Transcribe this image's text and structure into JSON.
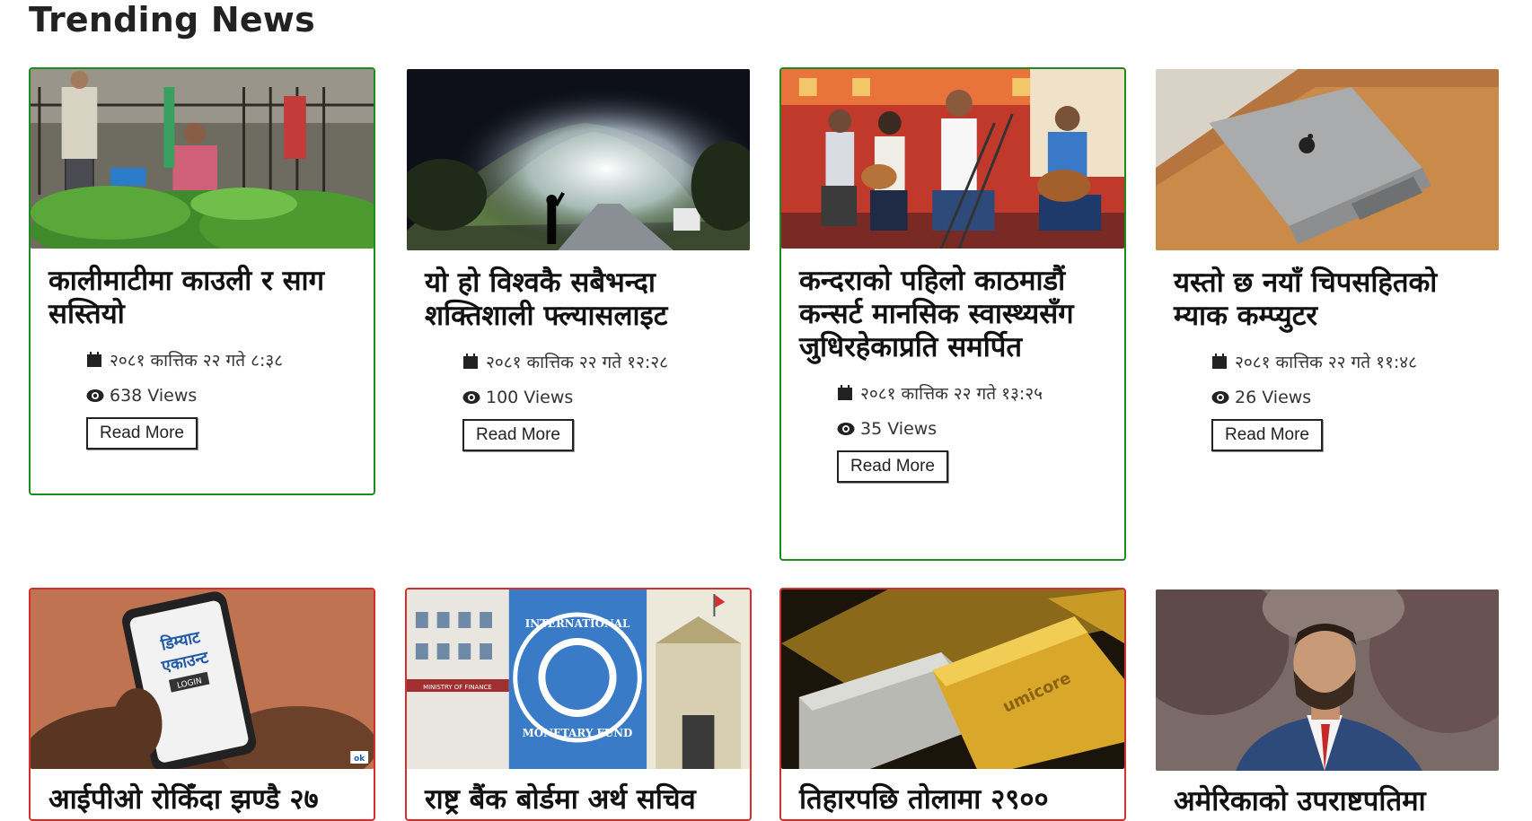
{
  "section": {
    "title": "Trending News"
  },
  "row1": [
    {
      "title": "कालीमाटीमा काउली र साग सस्तियो",
      "date": "२०८१ कात्तिक २२ गते ८:३८",
      "views": "638 Views",
      "read_more": "Read More",
      "image": "vegetable market"
    },
    {
      "title": "यो हो विश्वकै सबैभन्दा शक्तिशाली फ्ल्यासलाइट",
      "date": "२०८१ कात्तिक २२ गते १२:२८",
      "views": "100 Views",
      "read_more": "Read More",
      "image": "flashlight beam on hill at night"
    },
    {
      "title": "कन्दराको पहिलो काठमाडौं कन्सर्ट मानसिक स्वास्थ्यसँग जुधिरहेकाप्रति समर्पित",
      "date": "२०८१ कात्तिक २२ गते १३:२५",
      "views": "35 Views",
      "read_more": "Read More",
      "image": "band performing on stage"
    },
    {
      "title": "यस्तो छ नयाँ चिपसहितको म्याक कम्प्युटर",
      "date": "२०८१ कात्तिक २२ गते ११:४८",
      "views": "26 Views",
      "read_more": "Read More",
      "image": "laptop on desk"
    }
  ],
  "row2": [
    {
      "title": "आईपीओ रोकिँदा झण्डै २७",
      "image": "phone showing login",
      "phone_text_1": "डिम्याट",
      "phone_text_2": "एकाउन्ट",
      "phone_btn": "LOGIN",
      "badge": "ok"
    },
    {
      "title": "राष्ट्र बैंक बोर्डमा अर्थ सचिव",
      "image": "IMF logo with buildings",
      "imf_top": "INTERNATIONAL",
      "imf_bottom": "MONETARY FUND",
      "ministry_sign": "MINISTRY OF FINANCE"
    },
    {
      "title": "तिहारपछि तोलामा २९००",
      "image": "gold bars",
      "bar_text": "umicore"
    },
    {
      "title": "अमेरिकाको उपराष्टपतिमा",
      "image": "man in suit portrait"
    }
  ],
  "colors": {
    "green_border": "#1f8a1f",
    "red_border": "#d32f2f"
  },
  "icons": {
    "date": "calendar-icon",
    "views": "eye-icon"
  }
}
